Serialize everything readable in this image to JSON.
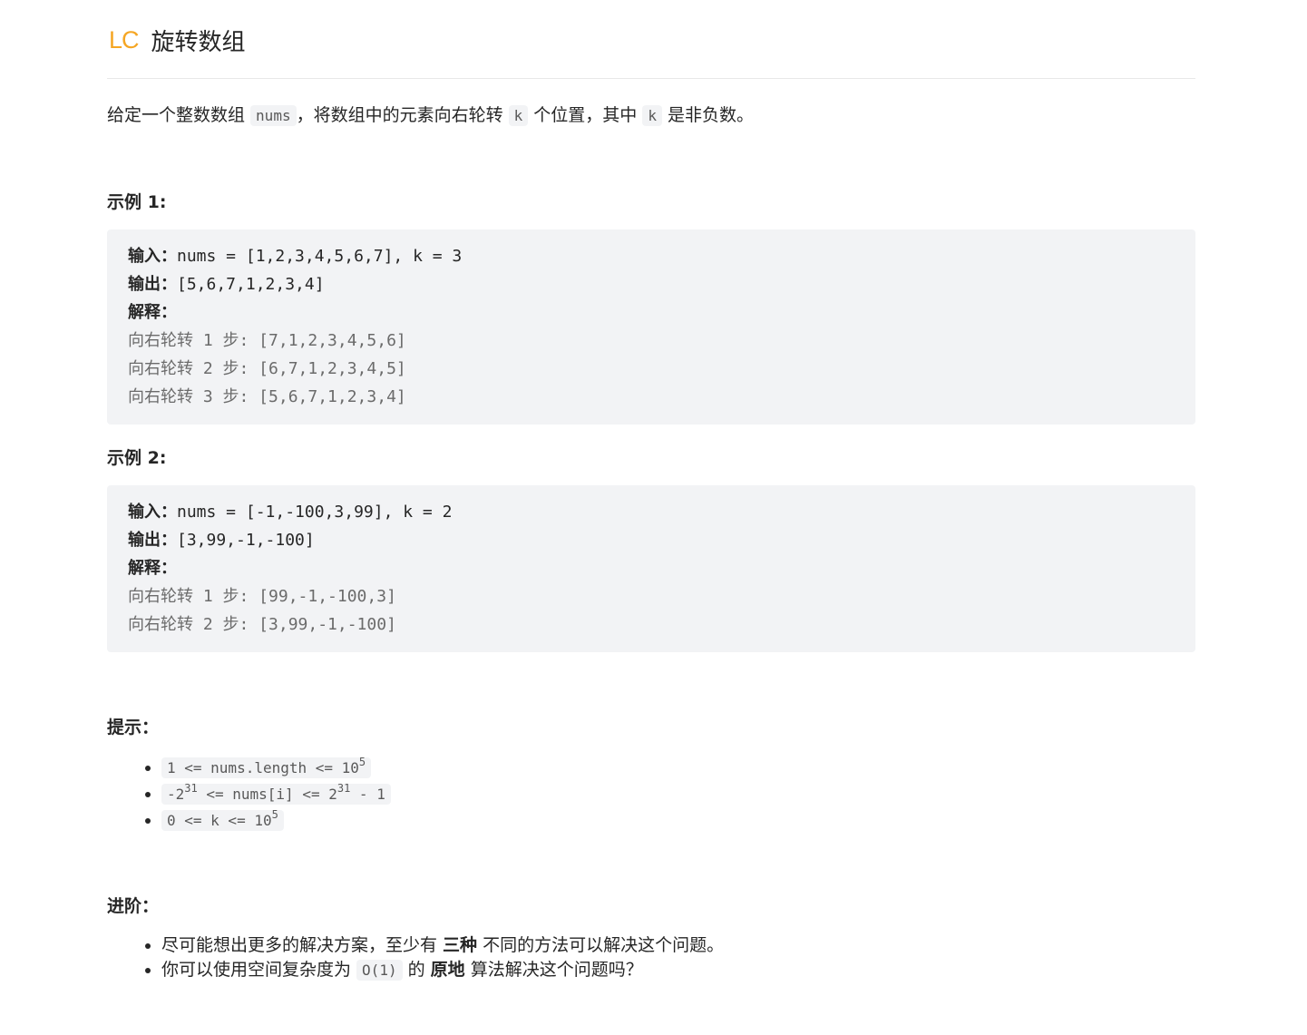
{
  "header": {
    "logo": "LC",
    "title": "旋转数组"
  },
  "description": {
    "t1": "给定一个整数数组 ",
    "c1": "nums",
    "t2": "，将数组中的元素向右轮转 ",
    "c2": "k",
    "t3": " 个位置，其中 ",
    "c3": "k",
    "t4": " 是非负数。"
  },
  "example1": {
    "heading": "示例 1:",
    "input_label": "输入：",
    "input_value": "nums = [1,2,3,4,5,6,7], k = 3",
    "output_label": "输出：",
    "output_value": "[5,6,7,1,2,3,4]",
    "explain_label": "解释：",
    "steps": [
      "向右轮转 1 步: [7,1,2,3,4,5,6]",
      "向右轮转 2 步: [6,7,1,2,3,4,5]",
      "向右轮转 3 步: [5,6,7,1,2,3,4]"
    ]
  },
  "example2": {
    "heading": "示例 2:",
    "input_label": "输入：",
    "input_value": "nums = [-1,-100,3,99], k = 2",
    "output_label": "输出：",
    "output_value": "[3,99,-1,-100]",
    "explain_label": "解释：",
    "steps": [
      "向右轮转 1 步: [99,-1,-100,3]",
      "向右轮转 2 步: [3,99,-1,-100]"
    ]
  },
  "hints": {
    "heading": "提示：",
    "h1_a": "1 <= nums.length <= 10",
    "h1_sup": "5",
    "h2_a": "-2",
    "h2_sup1": "31",
    "h2_b": " <= nums[i] <= 2",
    "h2_sup2": "31",
    "h2_c": " - 1",
    "h3_a": "0 <= k <= 10",
    "h3_sup": "5"
  },
  "advanced": {
    "heading": "进阶：",
    "a1_t1": "尽可能想出更多的解决方案，至少有 ",
    "a1_b": "三种",
    "a1_t2": " 不同的方法可以解决这个问题。",
    "a2_t1": "你可以使用空间复杂度为 ",
    "a2_code": "O(1)",
    "a2_t2": " 的 ",
    "a2_b": "原地",
    "a2_t3": " 算法解决这个问题吗？"
  }
}
